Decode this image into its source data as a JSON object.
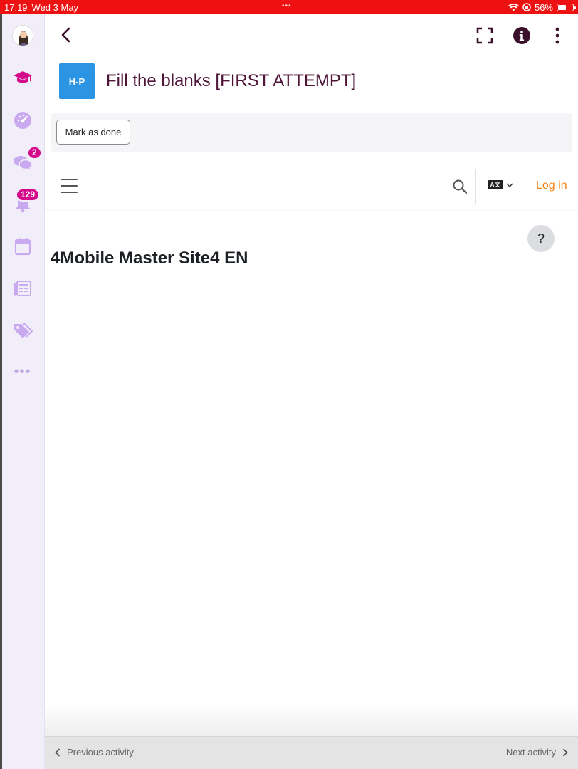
{
  "status_bar": {
    "time": "17:19",
    "date": "Wed 3 May",
    "battery": "56%",
    "battery_level": 0.56,
    "color": "#ee1111"
  },
  "side_menu": {
    "items": [
      {
        "name": "avatar"
      },
      {
        "name": "graduation-cap-icon"
      },
      {
        "name": "dashboard-gauge-icon"
      },
      {
        "name": "messages-icon",
        "badge": "2"
      },
      {
        "name": "bell-icon",
        "badge": "129"
      },
      {
        "name": "calendar-icon"
      },
      {
        "name": "news-icon"
      },
      {
        "name": "tags-icon"
      },
      {
        "name": "more-icon"
      }
    ]
  },
  "header": {
    "icons": [
      "back-icon",
      "fullscreen-icon",
      "info-icon",
      "more-vertical-icon"
    ]
  },
  "activity": {
    "logo_text": "H-P",
    "title": "Fill the blanks [FIRST ATTEMPT]",
    "mark_button": "Mark as done"
  },
  "site": {
    "login": "Log in",
    "lang_label": "A文",
    "help": "?",
    "name": "4Mobile Master Site4 EN"
  },
  "bottom_nav": {
    "prev": "Previous activity",
    "next": "Next activity"
  },
  "colors": {
    "accent": "#d40a8a",
    "title": "#4e1538",
    "login": "#f98012",
    "hp_blue": "#2b95e4"
  }
}
